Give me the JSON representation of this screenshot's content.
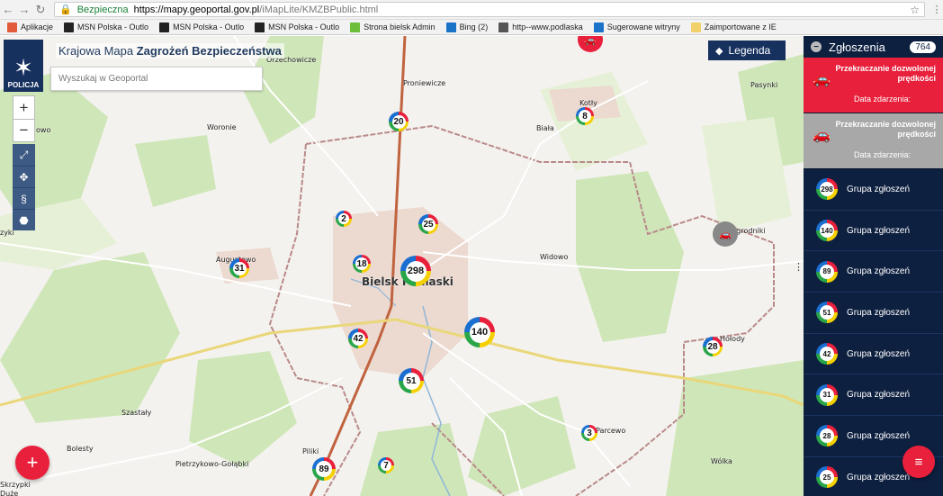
{
  "browser": {
    "secure_label": "Bezpieczna",
    "url_host": "https://mapy.geoportal.gov.pl",
    "url_path": "/iMapLite/KMZBPublic.html"
  },
  "bookmarks": [
    {
      "label": "Aplikacje",
      "color": "#e25b3a"
    },
    {
      "label": "MSN Polska - Outlo",
      "color": "#222222"
    },
    {
      "label": "MSN Polska - Outlo",
      "color": "#222222"
    },
    {
      "label": "MSN Polska - Outlo",
      "color": "#222222"
    },
    {
      "label": "Strona bielsk Admin",
      "color": "#6bbf3b"
    },
    {
      "label": "Bing (2)",
      "color": "#1a73c9"
    },
    {
      "label": "http--www.podlaska",
      "color": "#555555"
    },
    {
      "label": "Sugerowane witryny",
      "color": "#1a73c9"
    },
    {
      "label": "Zaimportowane z IE",
      "color": "#f2d16b"
    }
  ],
  "map": {
    "logo_text": "POLICJA",
    "title_prefix": "Krajowa Mapa",
    "title_strong": "Zagrożeń Bezpieczeństwa",
    "search_placeholder": "Wyszukaj w Geoportal",
    "legend_label": "Legenda",
    "labels": [
      {
        "text": "Orzechowicze",
        "type": "village"
      },
      {
        "text": "Proniewicze",
        "type": "village"
      },
      {
        "text": "Kotły",
        "type": "village"
      },
      {
        "text": "Pasynki",
        "type": "village"
      },
      {
        "text": "Woronie",
        "type": "village"
      },
      {
        "text": "Biała",
        "type": "village"
      },
      {
        "text": "Ogrodniki",
        "type": "village"
      },
      {
        "text": "Augustowo",
        "type": "village"
      },
      {
        "text": "Widowo",
        "type": "village"
      },
      {
        "text": "Bielsk Podlaski",
        "type": "town"
      },
      {
        "text": "Hołody",
        "type": "village"
      },
      {
        "text": "Szastały",
        "type": "village"
      },
      {
        "text": "Parcewo",
        "type": "village"
      },
      {
        "text": "Bolesty",
        "type": "village"
      },
      {
        "text": "Piliki",
        "type": "village"
      },
      {
        "text": "Pietrzykowo-Gołąbki",
        "type": "village"
      },
      {
        "text": "Wólka",
        "type": "village"
      },
      {
        "text": "Skrzypki",
        "type": "village"
      },
      {
        "text": "Duże",
        "type": "village"
      },
      {
        "text": "zyki",
        "type": "village"
      },
      {
        "text": "owo",
        "type": "village"
      }
    ],
    "clusters": [
      "20",
      "8",
      "2",
      "25",
      "18",
      "298",
      "31",
      "140",
      "42",
      "51",
      "28",
      "3",
      "89",
      "7"
    ]
  },
  "panel": {
    "title": "Zgłoszenia",
    "count": "764",
    "incidents": [
      {
        "title": "Przekraczanie dozwolonej prędkości",
        "date_label": "Data zdarzenia:",
        "color": "#e8203c"
      },
      {
        "title": "Przekraczanie dozwolonej prędkości",
        "date_label": "Data zdarzenia:",
        "color": "#a8a8a8"
      }
    ],
    "groups": [
      {
        "count": "298",
        "label": "Grupa zgłoszeń"
      },
      {
        "count": "140",
        "label": "Grupa zgłoszeń"
      },
      {
        "count": "89",
        "label": "Grupa zgłoszeń"
      },
      {
        "count": "51",
        "label": "Grupa zgłoszeń"
      },
      {
        "count": "42",
        "label": "Grupa zgłoszeń"
      },
      {
        "count": "31",
        "label": "Grupa zgłoszeń"
      },
      {
        "count": "28",
        "label": "Grupa zgłoszeń"
      },
      {
        "count": "25",
        "label": "Grupa zgłoszeń"
      }
    ]
  },
  "colors": {
    "accent": "#e8203c",
    "navy": "#0e2040",
    "ring": [
      "#e8203c",
      "#f5d000",
      "#2aa64a",
      "#1a6fd0"
    ]
  }
}
